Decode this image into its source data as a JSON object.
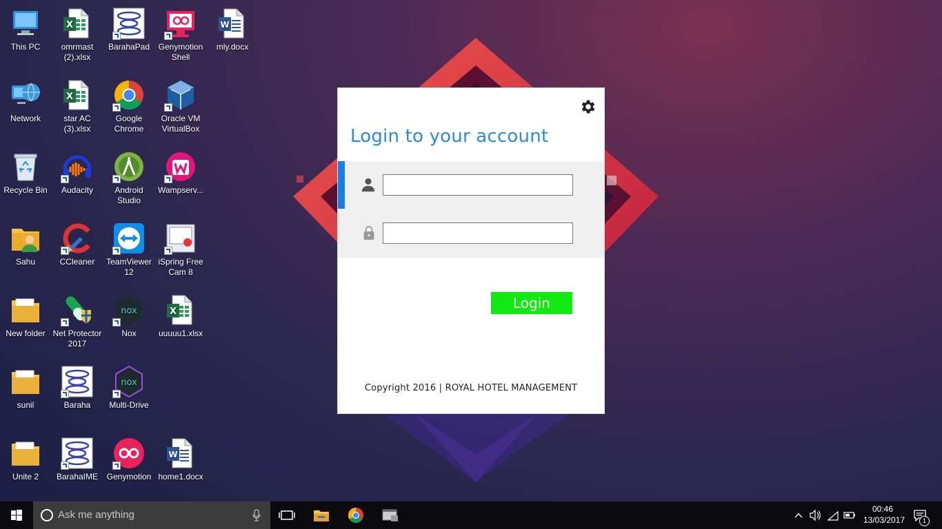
{
  "desktop": {
    "icons": [
      {
        "label": "This PC",
        "icon": "computer-icon"
      },
      {
        "label": "omrmast (2).xlsx",
        "icon": "excel-file-icon"
      },
      {
        "label": "BarahaPad",
        "icon": "baraha-icon"
      },
      {
        "label": "Genymotion Shell",
        "icon": "genymotion-shell-icon"
      },
      {
        "label": "mly.docx",
        "icon": "word-file-icon"
      },
      {
        "label": "Network",
        "icon": "network-icon"
      },
      {
        "label": "star AC (3).xlsx",
        "icon": "excel-file-icon"
      },
      {
        "label": "Google Chrome",
        "icon": "chrome-icon"
      },
      {
        "label": "Oracle VM VirtualBox",
        "icon": "virtualbox-icon"
      },
      {
        "label": "Recycle Bin",
        "icon": "recycle-bin-icon"
      },
      {
        "label": "Audacity",
        "icon": "audacity-icon"
      },
      {
        "label": "Android Studio",
        "icon": "android-studio-icon"
      },
      {
        "label": "Wampserv...",
        "icon": "wampserver-icon"
      },
      {
        "label": "Sahu",
        "icon": "user-folder-icon"
      },
      {
        "label": "CCleaner",
        "icon": "ccleaner-icon"
      },
      {
        "label": "TeamViewer 12",
        "icon": "teamviewer-icon"
      },
      {
        "label": "iSpring Free Cam 8",
        "icon": "ispring-icon"
      },
      {
        "label": "New folder",
        "icon": "folder-icon"
      },
      {
        "label": "Net Protector 2017",
        "icon": "net-protector-icon"
      },
      {
        "label": "Nox",
        "icon": "nox-icon"
      },
      {
        "label": "uuuuu1.xlsx",
        "icon": "excel-file-icon"
      },
      {
        "label": "sunil",
        "icon": "folder-icon"
      },
      {
        "label": "Baraha",
        "icon": "baraha-icon"
      },
      {
        "label": "Multi-Drive",
        "icon": "nox-multidrive-icon"
      },
      {
        "label": "Unite 2",
        "icon": "folder-icon"
      },
      {
        "label": "BarahaIME",
        "icon": "baraha-icon"
      },
      {
        "label": "Genymotion",
        "icon": "genymotion-icon"
      },
      {
        "label": "home1.docx",
        "icon": "word-file-icon"
      }
    ]
  },
  "login": {
    "title": "Login to your account",
    "username_value": "",
    "password_value": "",
    "button_label": "Login",
    "copyright": "Copyright 2016  |  ROYAL HOTEL MANAGEMENT",
    "colors": {
      "title": "#2a8ae0",
      "accent": "#1a7de0",
      "button": "#11ea11"
    }
  },
  "taskbar": {
    "search_placeholder": "Ask me anything",
    "pinned": [
      "task-view-icon",
      "file-explorer-icon",
      "chrome-icon",
      "app-window-icon"
    ],
    "time": "00:46",
    "date": "13/03/2017",
    "notification_count": "1"
  }
}
